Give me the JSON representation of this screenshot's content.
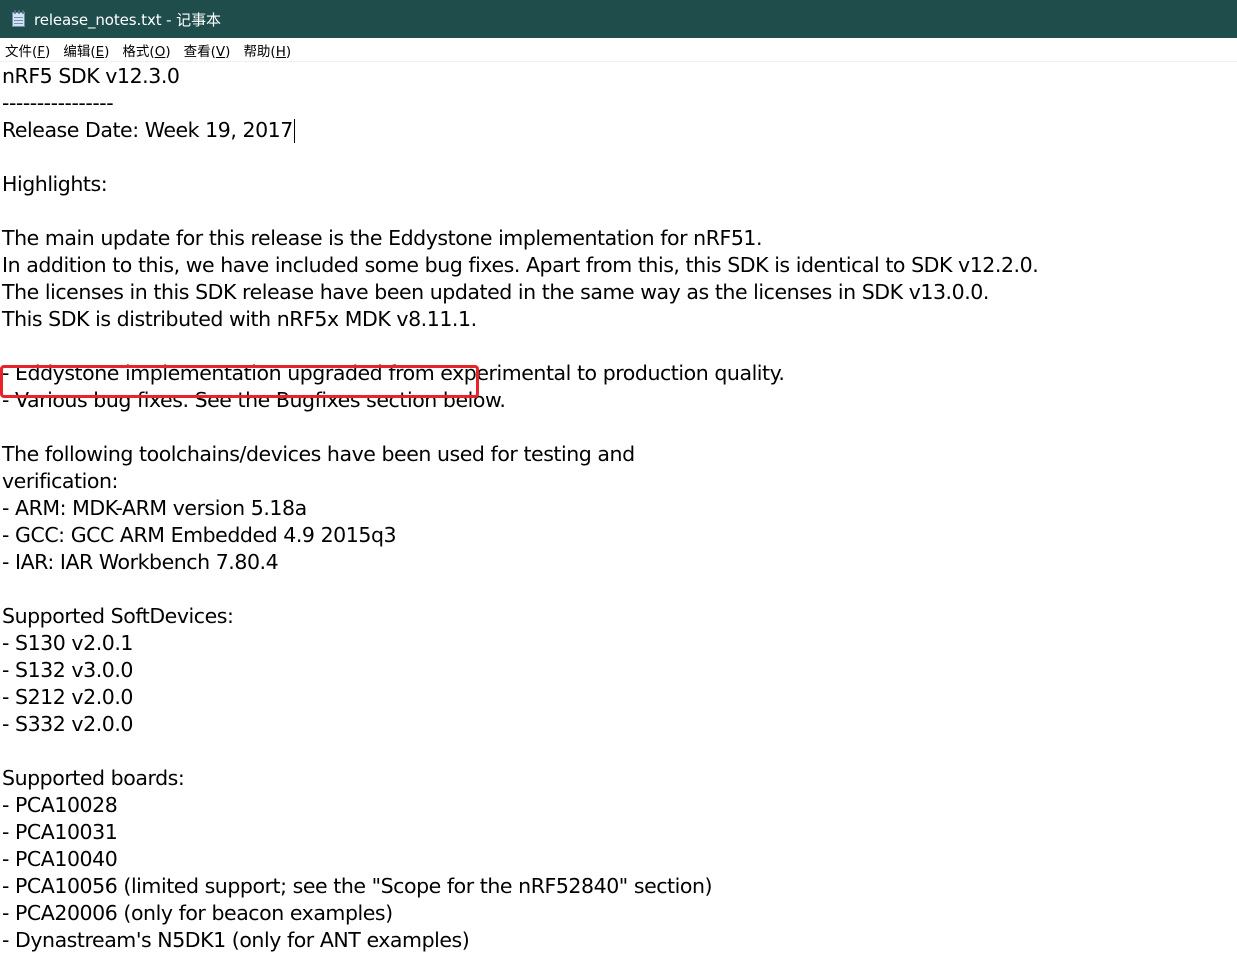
{
  "window": {
    "title": "release_notes.txt - 记事本",
    "titlebar_color": "#1e4d4c",
    "icon": "notepad-icon"
  },
  "menu": [
    {
      "label": "文件(",
      "accel": "F",
      "end": ")"
    },
    {
      "label": "编辑(",
      "accel": "E",
      "end": ")"
    },
    {
      "label": "格式(",
      "accel": "O",
      "end": ")"
    },
    {
      "label": "查看(",
      "accel": "V",
      "end": ")"
    },
    {
      "label": "帮助(",
      "accel": "H",
      "end": ")"
    }
  ],
  "annotation": {
    "color": "#e8232a",
    "highlighted_line": "This SDK is distributed with nRF5x MDK v8.11.1."
  },
  "lines": [
    "nRF5 SDK v12.3.0",
    "----------------",
    "Release Date: Week 19, 2017",
    "",
    "Highlights:",
    "",
    "The main update for this release is the Eddystone implementation for nRF51.",
    "In addition to this, we have included some bug fixes. Apart from this, this SDK is identical to SDK v12.2.0.",
    "The licenses in this SDK release have been updated in the same way as the licenses in SDK v13.0.0.",
    "This SDK is distributed with nRF5x MDK v8.11.1.",
    "",
    "- Eddystone implementation upgraded from experimental to production quality.",
    "- Various bug fixes. See the Bugfixes section below.",
    "",
    "The following toolchains/devices have been used for testing and",
    "verification:",
    "- ARM: MDK-ARM version 5.18a",
    "- GCC: GCC ARM Embedded 4.9 2015q3",
    "- IAR: IAR Workbench 7.80.4",
    "",
    "Supported SoftDevices:",
    "- S130 v2.0.1",
    "- S132 v3.0.0",
    "- S212 v2.0.0",
    "- S332 v2.0.0",
    "",
    "Supported boards:",
    "- PCA10028",
    "- PCA10031",
    "- PCA10040",
    "- PCA10056 (limited support; see the \"Scope for the nRF52840\" section)",
    "- PCA20006 (only for beacon examples)",
    "- Dynastream's N5DK1 (only for ANT examples)"
  ]
}
